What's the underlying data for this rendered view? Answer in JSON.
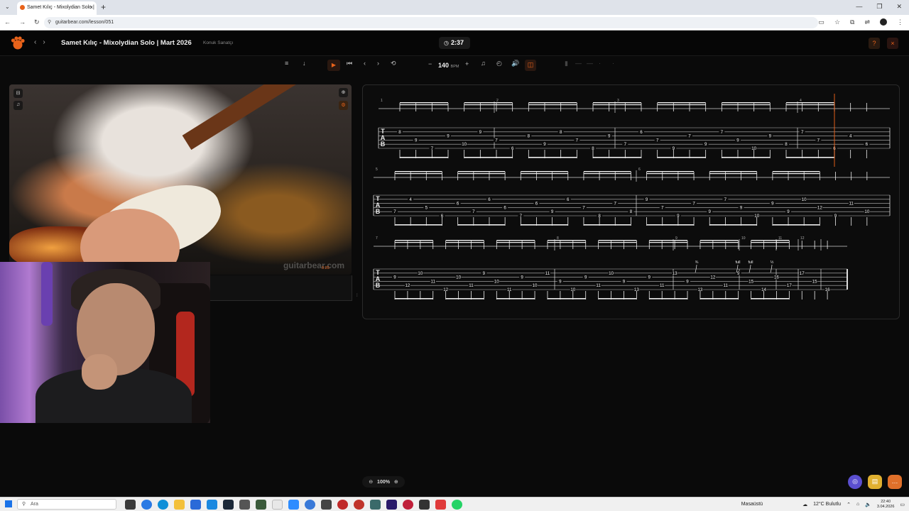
{
  "browser": {
    "tab_title": "Samet Kılıç - Mixolydian Solo |",
    "url": "guitarbear.com/lesson/051"
  },
  "app": {
    "title": "Samet Kılıç - Mixolydian Solo | Mart 2026",
    "subtitle": "Konuk Sanatçı",
    "timer": "2:37",
    "help_label": "?",
    "close_label": "×"
  },
  "toolbar": {
    "bpm_value": "140",
    "bpm_unit": "BPM",
    "minus": "−",
    "plus": "+"
  },
  "video": {
    "watermark": "guitarbear.com",
    "time": "0:20"
  },
  "sheet": {
    "measure_numbers": [
      "1",
      "2",
      "3",
      "4",
      "5",
      "6",
      "7",
      "8",
      "9",
      "10",
      "11",
      "12"
    ],
    "row1_frets": [
      "8",
      "9",
      "7",
      "9",
      "10",
      "9",
      "7",
      "6",
      "8",
      "9",
      "8",
      "7",
      "8",
      "9",
      "7",
      "6",
      "7",
      "9",
      "7",
      "9",
      "7",
      "9",
      "10",
      "9",
      "8",
      "7",
      "7",
      "6",
      "4",
      "6"
    ],
    "row2_frets": [
      "7",
      "4",
      "5",
      "6",
      "6",
      "7",
      "6",
      "6",
      "7",
      "6",
      "9",
      "6",
      "7",
      "8",
      "7",
      "8",
      "9",
      "7",
      "9",
      "7",
      "9",
      "7",
      "9",
      "10",
      "9",
      "9",
      "10",
      "12",
      "9",
      "11",
      "10"
    ],
    "row3_frets": [
      "9",
      "12",
      "10",
      "11",
      "12",
      "10",
      "11",
      "9",
      "10",
      "11",
      "9",
      "10",
      "11",
      "9",
      "10",
      "9",
      "11",
      "10",
      "9",
      "13",
      "9",
      "11",
      "13",
      "9",
      "13",
      "12",
      "11",
      "9",
      "15",
      "14",
      "16",
      "17",
      "17",
      "15",
      "16"
    ],
    "bend_labels": [
      "¾",
      "full",
      "full",
      "½"
    ],
    "tab_clef": [
      "T",
      "A",
      "B"
    ]
  },
  "zoom": {
    "level": "100%"
  },
  "taskbar": {
    "search_placeholder": "Ara",
    "desktop_label": "Masaüstü",
    "weather": "12°C  Bulutlu",
    "time": "22:40",
    "date": "3.04.2026"
  },
  "colors": {
    "accent": "#e8621a",
    "background": "#0a0a0a"
  }
}
